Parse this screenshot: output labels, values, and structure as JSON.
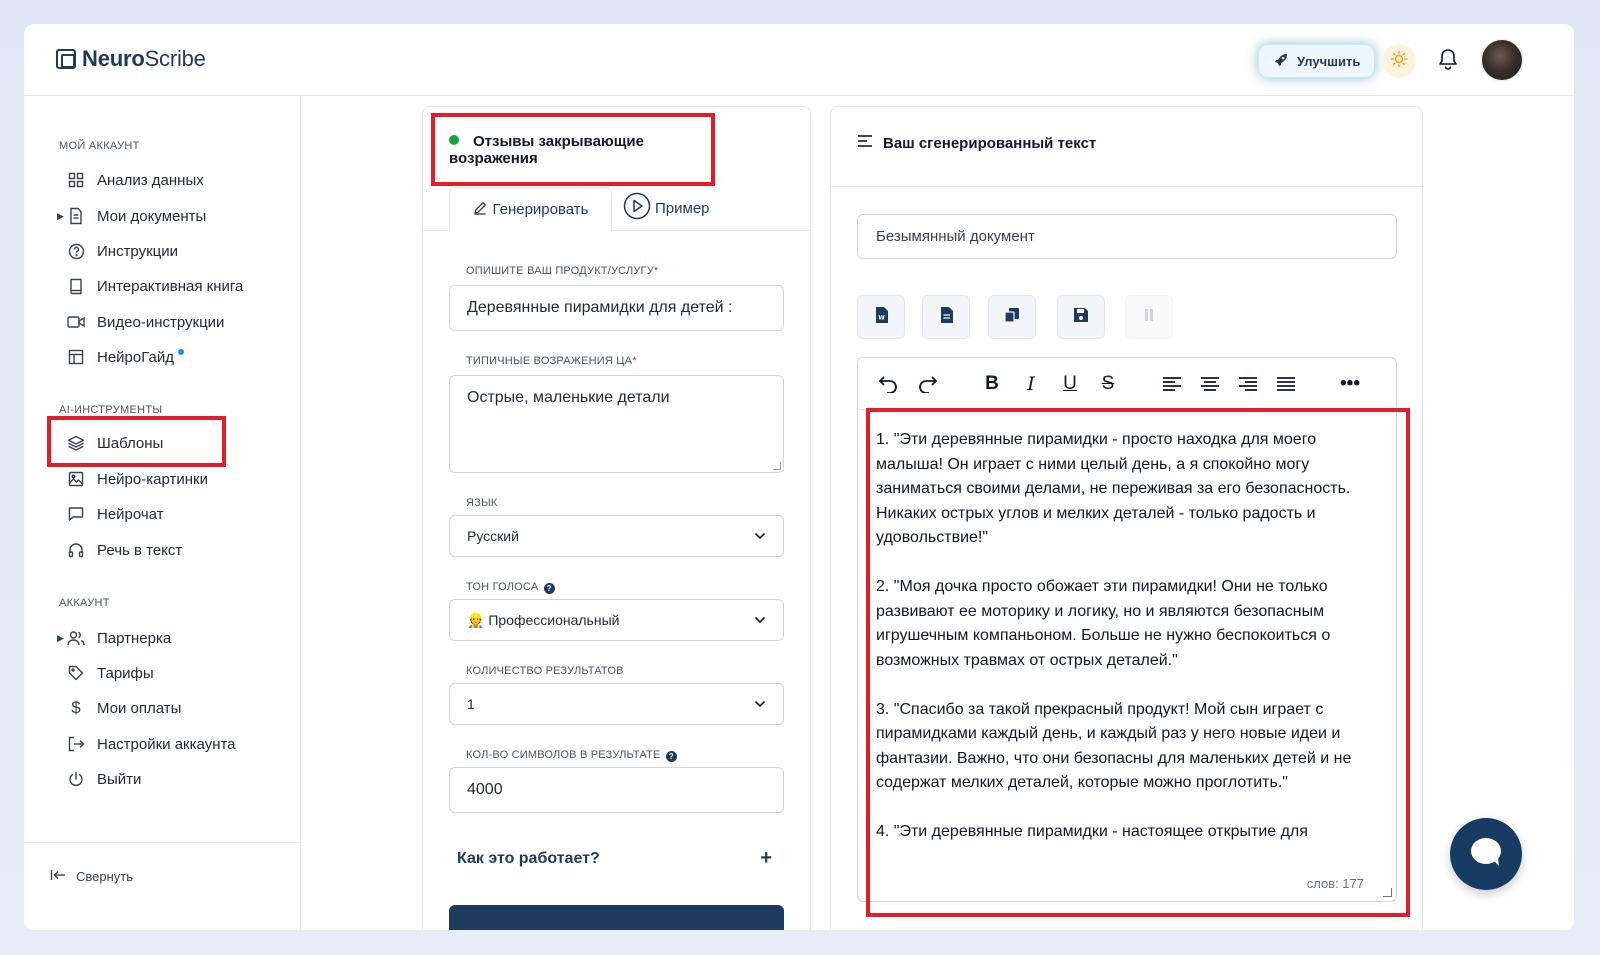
{
  "app": {
    "logo_bold": "Neuro",
    "logo_rest": "Scribe"
  },
  "header": {
    "upgrade_label": "Улучшить",
    "icons": [
      "rocket-icon",
      "sun-icon",
      "bell-icon"
    ]
  },
  "sidebar": {
    "section_account_mine": "МОЙ АККАУНТ",
    "section_ai_tools": "AI-ИНСТРУМЕНТЫ",
    "section_account": "АККАУНТ",
    "items": [
      {
        "label": "Анализ данных",
        "icon": "grid-icon"
      },
      {
        "label": "Мои документы",
        "icon": "document-icon"
      },
      {
        "label": "Инструкции",
        "icon": "question-circle-icon"
      },
      {
        "label": "Интерактивная книга",
        "icon": "book-icon"
      },
      {
        "label": "Видео-инструкции",
        "icon": "video-icon"
      },
      {
        "label": "НейроГайд",
        "icon": "table-icon"
      },
      {
        "label": "Шаблоны",
        "icon": "layers-icon"
      },
      {
        "label": "Нейро-картинки",
        "icon": "image-icon"
      },
      {
        "label": "Нейрочат",
        "icon": "chat-icon"
      },
      {
        "label": "Речь в текст",
        "icon": "headphones-icon"
      },
      {
        "label": "Партнерка",
        "icon": "users-icon"
      },
      {
        "label": "Тарифы",
        "icon": "tag-icon"
      },
      {
        "label": "Мои оплаты",
        "icon": "dollar-icon"
      },
      {
        "label": "Настройки аккаунта",
        "icon": "sign-out-icon"
      },
      {
        "label": "Выйти",
        "icon": "power-icon"
      }
    ],
    "collapse_label": "Свернуть"
  },
  "form": {
    "template_title": "Отзывы закрывающие возражения",
    "tab_generate": "Генерировать",
    "tab_example": "Пример",
    "product_label": "ОПИШИТЕ ВАШ ПРОДУКТ/УСЛУГУ",
    "product_value": "Деревянные пирамидки для детей :",
    "objections_label": "ТИПИЧНЫЕ ВОЗРАЖЕНИЯ ЦА",
    "objections_value": "Острые, маленькие детали",
    "language_label": "ЯЗЫК",
    "language_value": "Русский",
    "tone_label": "ТОН ГОЛОСА",
    "tone_value": "👷 Профессиональный",
    "results_label": "КОЛИЧЕСТВО РЕЗУЛЬТАТОВ",
    "results_value": "1",
    "chars_label": "КОЛ-ВО СИМВОЛОВ В РЕЗУЛЬТАТЕ",
    "chars_value": "4000",
    "how_label": "Как это работает?",
    "required_mark": "*"
  },
  "output": {
    "title": "Ваш сгенерированный текст",
    "doc_name": "Безымянный документ",
    "paragraphs": [
      "1. \"Эти деревянные пирамидки - просто находка для моего малыша! Он играет с ними целый день, а я спокойно могу заниматься своими делами, не переживая за его безопасность. Никаких острых углов и мелких деталей - только радость и удовольствие!\"",
      "2. \"Моя дочка просто обожает эти пирамидки! Они не только развивают ее моторику и логику, но и являются безопасным игрушечным компаньоном. Больше не нужно беспокоиться о возможных травмах от острых деталей.\"",
      "3. \"Спасибо за такой прекрасный продукт! Мой сын играет с пирамидками каждый день, и каждый раз у него новые идеи и фантазии. Важно, что они безопасны для маленьких детей и не содержат мелких деталей, которые можно проглотить.\"",
      "4. \"Эти деревянные пирамидки - настоящее открытие для"
    ],
    "word_count": "слов: 177"
  },
  "colors": {
    "highlight": "#e11d2a",
    "brand": "#1e3a5f",
    "status_green": "#16a34a"
  }
}
